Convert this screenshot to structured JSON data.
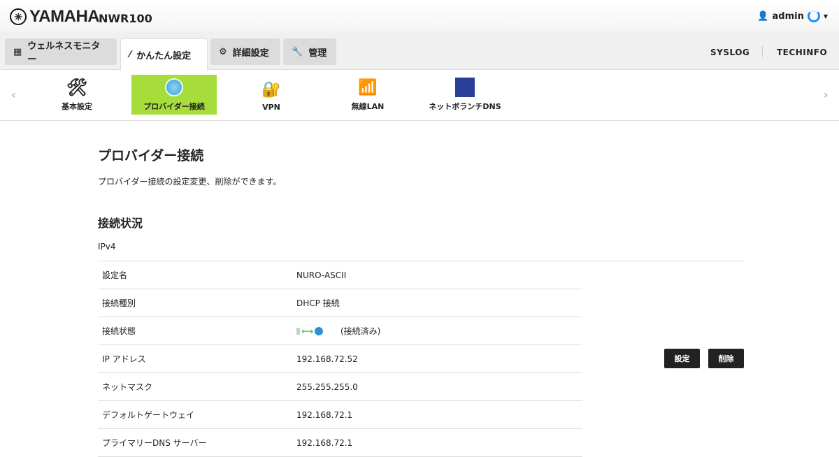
{
  "header": {
    "brand": "YAMAHA",
    "model": "NWR100",
    "user": "admin"
  },
  "tabs": [
    {
      "label": "ウェルネスモニター"
    },
    {
      "label": "かんたん設定"
    },
    {
      "label": "詳細設定"
    },
    {
      "label": "管理"
    }
  ],
  "right_links": {
    "syslog": "SYSLOG",
    "techinfo": "TECHINFO"
  },
  "subnav": [
    {
      "label": "基本設定"
    },
    {
      "label": "プロバイダー接続"
    },
    {
      "label": "VPN"
    },
    {
      "label": "無線LAN"
    },
    {
      "label": "ネットボランチDNS"
    }
  ],
  "main": {
    "title": "プロバイダー接続",
    "description": "プロバイダー接続の設定変更、削除ができます。",
    "section": "接続状況",
    "ip_version": "IPv4",
    "rows": [
      {
        "label": "設定名",
        "value": "NURO-ASCII"
      },
      {
        "label": "接続種別",
        "value": "DHCP 接続"
      },
      {
        "label": "接続状態",
        "value": "(接続済み)"
      },
      {
        "label": "IP アドレス",
        "value": "192.168.72.52"
      },
      {
        "label": "ネットマスク",
        "value": "255.255.255.0"
      },
      {
        "label": "デフォルトゲートウェイ",
        "value": "192.168.72.1"
      },
      {
        "label": "プライマリーDNS サーバー",
        "value": "192.168.72.1"
      }
    ],
    "buttons": {
      "settings": "設定",
      "delete": "削除"
    }
  },
  "colors": {
    "active_subnav": "#a6dd3a",
    "accent": "#1e90ff"
  }
}
